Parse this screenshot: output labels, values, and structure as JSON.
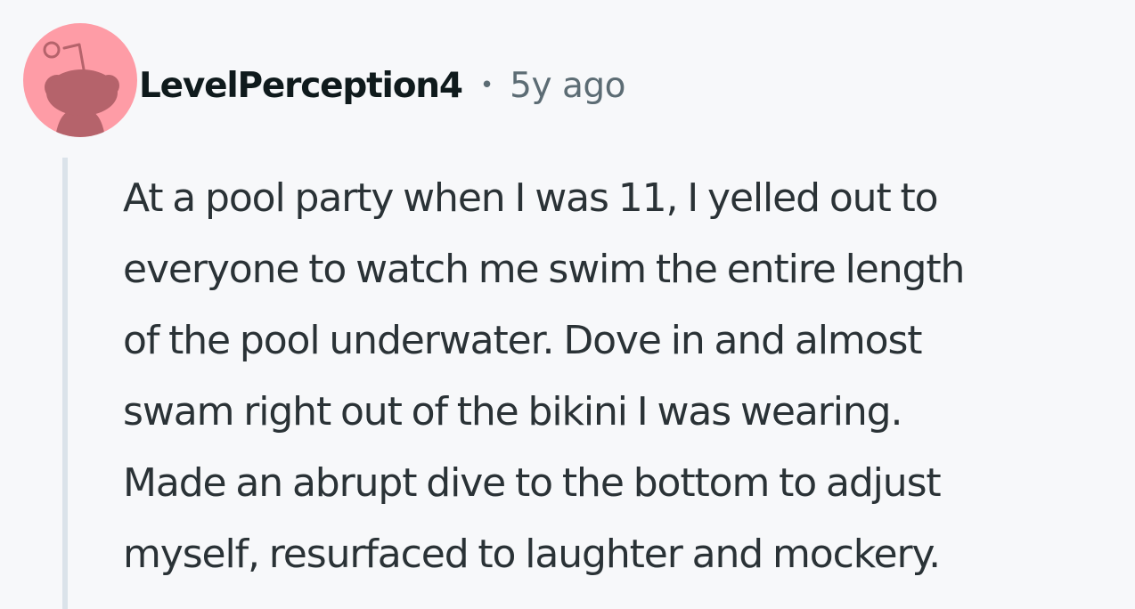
{
  "comment": {
    "author": "LevelPerception4",
    "separator": "•",
    "timestamp": "5y ago",
    "body_lines": [
      "At a pool party when I was 11, I yelled out to",
      "everyone to watch me swim the entire length",
      "of the pool underwater. Dove in and almost",
      "swam right out of the bikini I was wearing.",
      "Made an abrupt dive to the bottom to adjust",
      "myself, resurfaced to laughter and mockery."
    ]
  },
  "avatar": {
    "icon": "snoo-avatar-icon",
    "background_color": "#fe9ca6",
    "figure_color": "#b5636b"
  },
  "colors": {
    "page_background": "#f7f8fa",
    "author_text": "#0f1a1c",
    "meta_text": "#5c6c74",
    "body_text": "#2a3236",
    "thread_line": "#dbe3ea"
  }
}
